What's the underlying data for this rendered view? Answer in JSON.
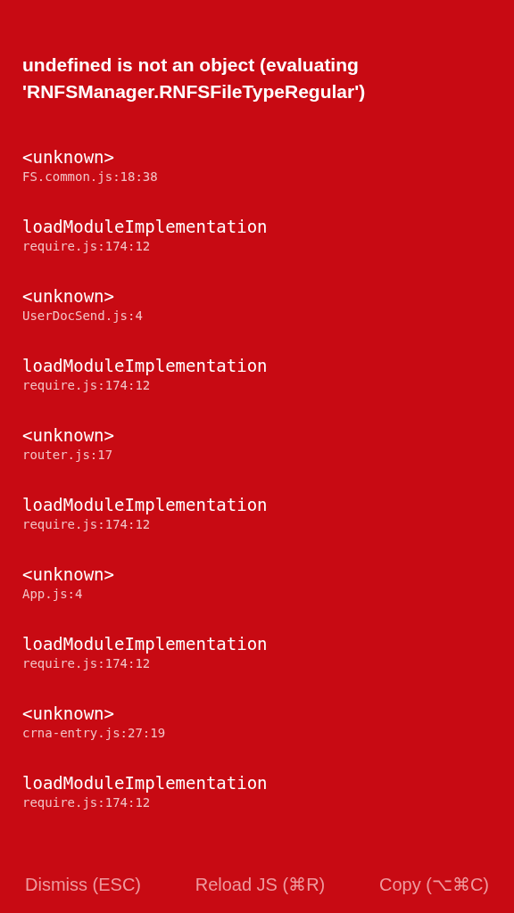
{
  "error": {
    "message": "undefined is not an object (evaluating 'RNFSManager.RNFSFileTypeRegular')"
  },
  "stack": [
    {
      "method": "<unknown>",
      "location": "FS.common.js:18:38"
    },
    {
      "method": "loadModuleImplementation",
      "location": "require.js:174:12"
    },
    {
      "method": "<unknown>",
      "location": "UserDocSend.js:4"
    },
    {
      "method": "loadModuleImplementation",
      "location": "require.js:174:12"
    },
    {
      "method": "<unknown>",
      "location": "router.js:17"
    },
    {
      "method": "loadModuleImplementation",
      "location": "require.js:174:12"
    },
    {
      "method": "<unknown>",
      "location": "App.js:4"
    },
    {
      "method": "loadModuleImplementation",
      "location": "require.js:174:12"
    },
    {
      "method": "<unknown>",
      "location": "crna-entry.js:27:19"
    },
    {
      "method": "loadModuleImplementation",
      "location": "require.js:174:12"
    }
  ],
  "buttons": [
    "Dismiss (ESC)",
    "Reload JS (⌘R)",
    "Copy (⌥⌘C)"
  ]
}
